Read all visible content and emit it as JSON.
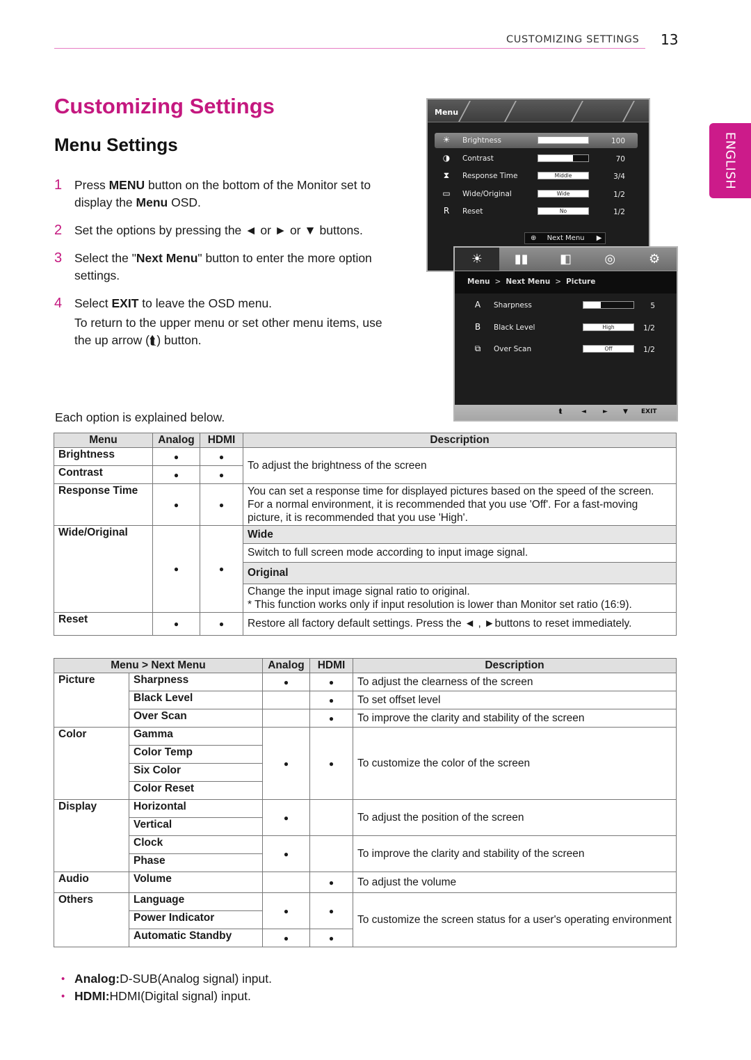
{
  "header": {
    "section": "CUSTOMIZING SETTINGS",
    "page_number": "13"
  },
  "language_tab": "ENGLISH",
  "title": "Customizing Settings",
  "subtitle": "Menu Settings",
  "steps": [
    {
      "num": "1",
      "pre": "Press ",
      "b1": "MENU",
      "mid": " button on the bottom of the Monitor set to display the ",
      "b2": "Menu",
      "post": " OSD."
    },
    {
      "num": "2",
      "text": "Set the options by pressing the ◄ or ► or ▼ buttons."
    },
    {
      "num": "3",
      "pre": "Select the \"",
      "b1": "Next Menu",
      "post": "\" button to enter the more option settings."
    },
    {
      "num": "4",
      "pre": "Select ",
      "b1": "EXIT",
      "post": " to leave the OSD menu.",
      "extra": "To return to the upper menu or set other menu items, use the up arrow (⮬) button."
    }
  ],
  "explained": "Each option is explained below.",
  "osd_main": {
    "title": "Menu",
    "rows": [
      {
        "icon": "brightness-icon",
        "glyph": "☀",
        "label": "Brightness",
        "value": "100",
        "fill": 1.0,
        "selected": true
      },
      {
        "icon": "contrast-icon",
        "glyph": "◑",
        "label": "Contrast",
        "value": "70",
        "fill": 0.7
      },
      {
        "icon": "response-time-icon",
        "glyph": "⧗",
        "label": "Response Time",
        "option": "Middle",
        "value": "3/4"
      },
      {
        "icon": "wide-original-icon",
        "glyph": "▭",
        "label": "Wide/Original",
        "option": "Wide",
        "value": "1/2"
      },
      {
        "icon": "reset-icon",
        "glyph": "R",
        "label": "Reset",
        "option": "No",
        "value": "1/2"
      }
    ],
    "next_menu": "Next Menu"
  },
  "osd_next": {
    "tabs": [
      "picture-tab",
      "color-tab",
      "display-tab",
      "audio-tab",
      "others-tab"
    ],
    "breadcrumb": [
      "Menu",
      "Next Menu",
      "Picture"
    ],
    "rows": [
      {
        "icon": "sharpness-icon",
        "glyph": "A",
        "label": "Sharpness",
        "value": "5",
        "fill": 0.35
      },
      {
        "icon": "black-level-icon",
        "glyph": "B",
        "label": "Black Level",
        "option": "High",
        "value": "1/2"
      },
      {
        "icon": "over-scan-icon",
        "glyph": "⧉",
        "label": "Over Scan",
        "option": "Off",
        "value": "1/2"
      }
    ],
    "footer": {
      "up": "⮬",
      "left": "◄",
      "right": "►",
      "down": "▼",
      "exit": "EXIT"
    }
  },
  "table1": {
    "headers": [
      "Menu",
      "Analog",
      "HDMI",
      "Description"
    ],
    "dot": "●",
    "brightness": "Brightness",
    "contrast": "Contrast",
    "brightness_desc": "To adjust the brightness of the screen",
    "response_time": "Response Time",
    "response_desc": "You can set a response time for displayed pictures based on the speed of the screen. For a normal environment, it is recommended that you use 'Off'. For a fast-moving picture, it is recommended that you use 'High'.",
    "wide_original": "Wide/Original",
    "wide": "Wide",
    "wide_desc": "Switch to full screen mode according to input image signal.",
    "original": "Original",
    "original_desc": "Change the input image signal ratio to original.",
    "original_note": "* This function works only if input resolution is lower than Monitor set ratio (16:9).",
    "reset": "Reset",
    "reset_desc": "Restore all factory default settings. Press the ◄ , ►buttons to reset immediately."
  },
  "table2": {
    "headers": [
      "Menu > Next Menu",
      "Analog",
      "HDMI",
      "Description"
    ],
    "dot": "●",
    "picture": "Picture",
    "sharpness": "Sharpness",
    "sharpness_desc": "To adjust the clearness of the screen",
    "black_level": "Black Level",
    "black_level_desc": "To set offset level",
    "over_scan": "Over Scan",
    "over_scan_desc": "To improve the clarity and stability of the screen",
    "color": "Color",
    "gamma": "Gamma",
    "color_temp": "Color Temp",
    "six_color": "Six Color",
    "color_reset": "Color Reset",
    "color_desc": "To customize the color of the screen",
    "display": "Display",
    "horizontal": "Horizontal",
    "vertical": "Vertical",
    "position_desc": "To adjust the position of the screen",
    "clock": "Clock",
    "phase": "Phase",
    "clarity_desc": "To improve the clarity and stability of the screen",
    "audio": "Audio",
    "volume": "Volume",
    "volume_desc": "To adjust the volume",
    "others": "Others",
    "language": "Language",
    "power_indicator": "Power Indicator",
    "automatic_standby": "Automatic Standby",
    "others_desc": "To customize the screen status for a user's operating environment"
  },
  "legend": [
    {
      "term": "Analog:",
      "text": " D-SUB(Analog signal) input."
    },
    {
      "term": "HDMI:",
      "text": " HDMI(Digital signal) input."
    }
  ]
}
